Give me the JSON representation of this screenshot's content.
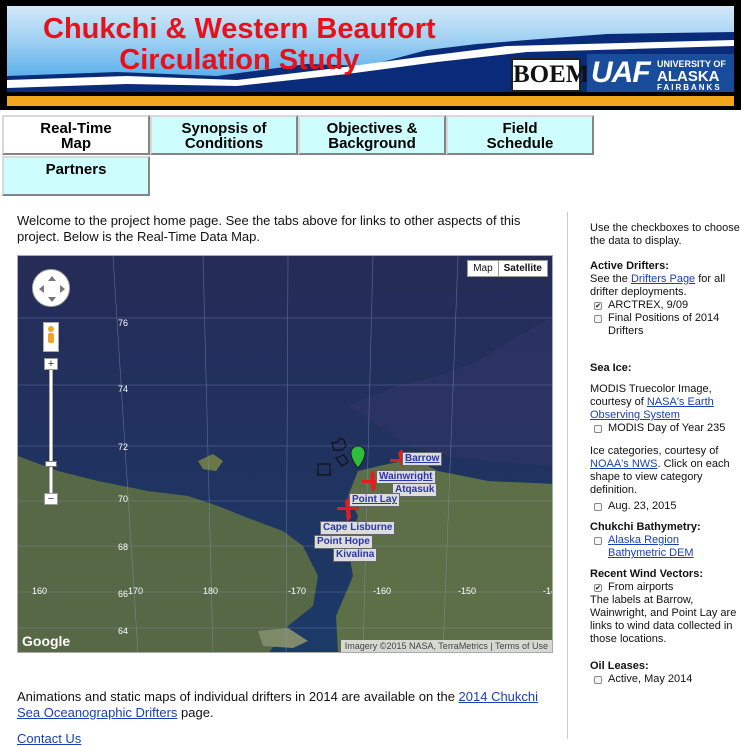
{
  "banner": {
    "title_line1": "Chukchi & Western Beaufort",
    "title_line2": "Circulation Study",
    "boem_logo": "BOEM",
    "uaf_logo": {
      "abbr": "UAF",
      "line1": "UNIVERSITY OF",
      "line2": "ALASKA",
      "line3": "FAIRBANKS"
    }
  },
  "tabs": [
    {
      "label": "Real-Time\nMap",
      "active": true
    },
    {
      "label": "Synopsis of\nConditions",
      "active": false
    },
    {
      "label": "Objectives &\nBackground",
      "active": false
    },
    {
      "label": "Field\nSchedule",
      "active": false
    },
    {
      "label": "Partners",
      "active": false
    }
  ],
  "intro": "Welcome to the project home page. See the tabs above for links to other aspects of this project. Below is the Real-Time Data Map.",
  "map": {
    "map_button": "Map",
    "satellite_button": "Satellite",
    "latitudes": [
      "76",
      "74",
      "72",
      "70",
      "68",
      "66",
      "64"
    ],
    "longitudes": [
      "160",
      "170",
      "180",
      "-170",
      "-160",
      "-150",
      "-14"
    ],
    "towns": [
      "Barrow",
      "Wainwright",
      "Atqasuk",
      "Point Lay",
      "Cape Lisburne",
      "Point Hope",
      "Kivalina"
    ],
    "google": "Google",
    "credit": "Imagery ©2015 NASA, TerraMetrics  | Terms of Use"
  },
  "footer": {
    "text_before": "Animations and static maps of individual drifters in 2014 are available on the ",
    "link": "2014 Chukchi Sea Oceanographic Drifters",
    "text_after": " page.",
    "contact": "Contact Us"
  },
  "sidebar": {
    "intro": "Use the checkboxes to choose the data to display.",
    "active_drifters": {
      "heading": "Active Drifters:",
      "text_before": "See the ",
      "link": "Drifters Page",
      "text_after": " for all drifter deployments.",
      "options": [
        {
          "label": "ARCTREX, 9/09",
          "checked": true
        },
        {
          "label": "Final Positions of 2014 Drifters",
          "checked": false
        }
      ]
    },
    "sea_ice": {
      "heading": "Sea Ice:",
      "modis_text": "MODIS Truecolor Image, courtesy of ",
      "modis_link": "NASA's Earth Observing System",
      "modis_option": "MODIS Day of Year 235",
      "ice_text_before": "Ice categories, courtesy of ",
      "ice_link": "NOAA's NWS",
      "ice_text_after": ". Click on each shape to view category definition.",
      "ice_option": "Aug. 23, 2015"
    },
    "bathymetry": {
      "heading": "Chukchi Bathymetry:",
      "link": "Alaska Region Bathymetric DEM"
    },
    "wind": {
      "heading": "Recent Wind Vectors:",
      "option": "From airports",
      "note": "The labels at Barrow, Wainwright, and Point Lay are links to wind data collected in those locations."
    },
    "oil": {
      "heading": "Oil Leases:",
      "option": "Active, May 2014"
    }
  },
  "colors": {
    "title_red": "#e8101a",
    "tab_bg": "#cdfdfc",
    "link": "#1a3fb0",
    "stripe": "#f3a51c",
    "marker_red": "#e11d1d"
  }
}
